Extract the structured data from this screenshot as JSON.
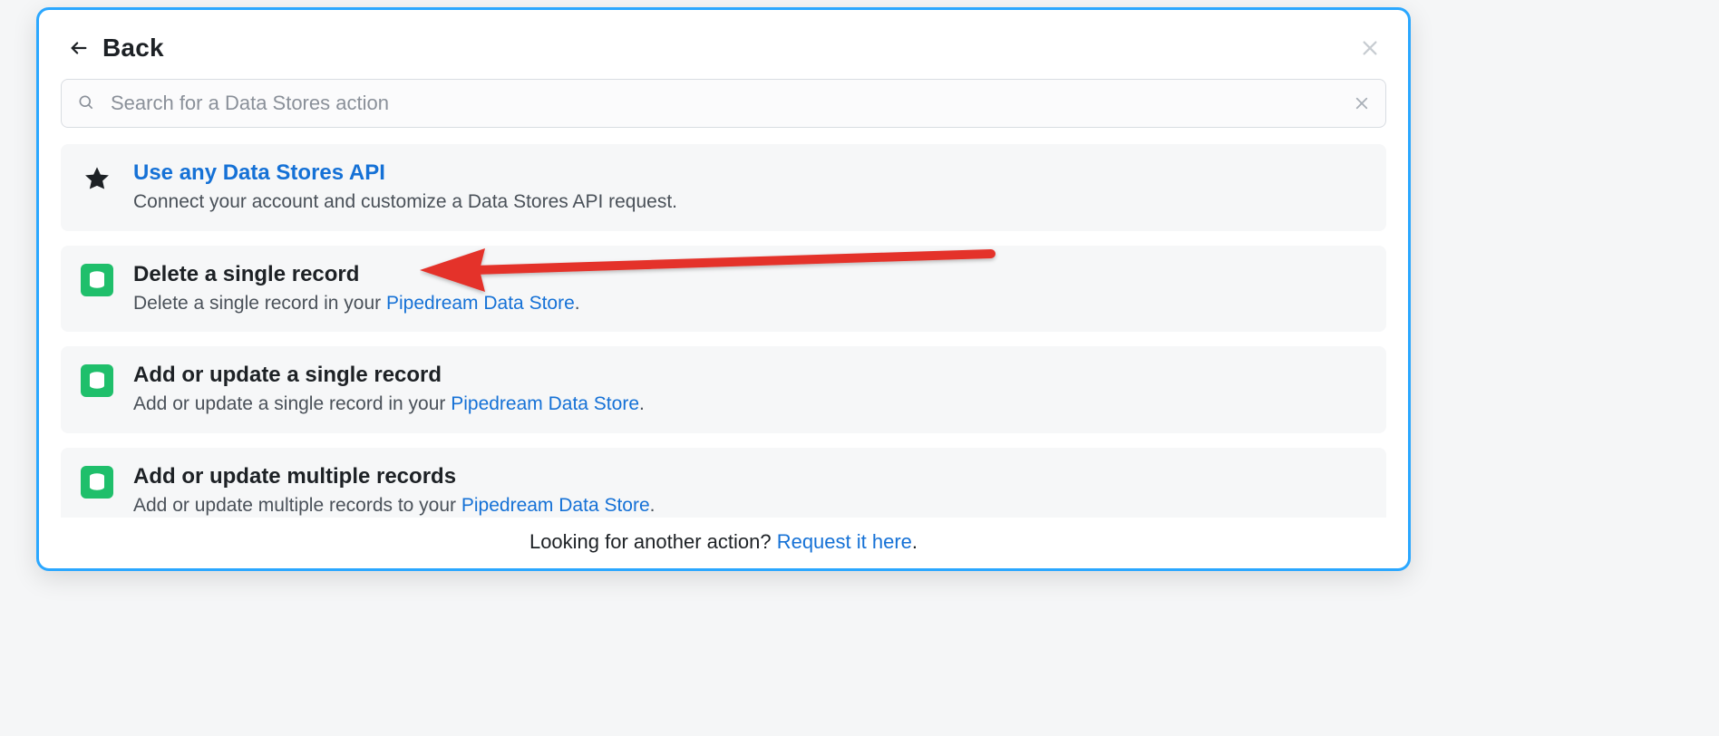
{
  "header": {
    "back_label": "Back"
  },
  "search": {
    "placeholder": "Search for a Data Stores action",
    "value": ""
  },
  "actions": [
    {
      "icon": "star",
      "title": "Use any Data Stores API",
      "title_is_link": true,
      "desc_pre": "Connect your account and customize a Data Stores API request.",
      "desc_link": "",
      "desc_post": ""
    },
    {
      "icon": "datastore",
      "title": "Delete a single record",
      "title_is_link": false,
      "desc_pre": "Delete a single record in your ",
      "desc_link": "Pipedream Data Store",
      "desc_post": "."
    },
    {
      "icon": "datastore",
      "title": "Add or update a single record",
      "title_is_link": false,
      "desc_pre": "Add or update a single record in your ",
      "desc_link": "Pipedream Data Store",
      "desc_post": "."
    },
    {
      "icon": "datastore",
      "title": "Add or update multiple records",
      "title_is_link": false,
      "desc_pre": "Add or update multiple records to your ",
      "desc_link": "Pipedream Data Store",
      "desc_post": "."
    }
  ],
  "footer": {
    "prompt": "Looking for another action? ",
    "link_text": "Request it here",
    "suffix": "."
  }
}
